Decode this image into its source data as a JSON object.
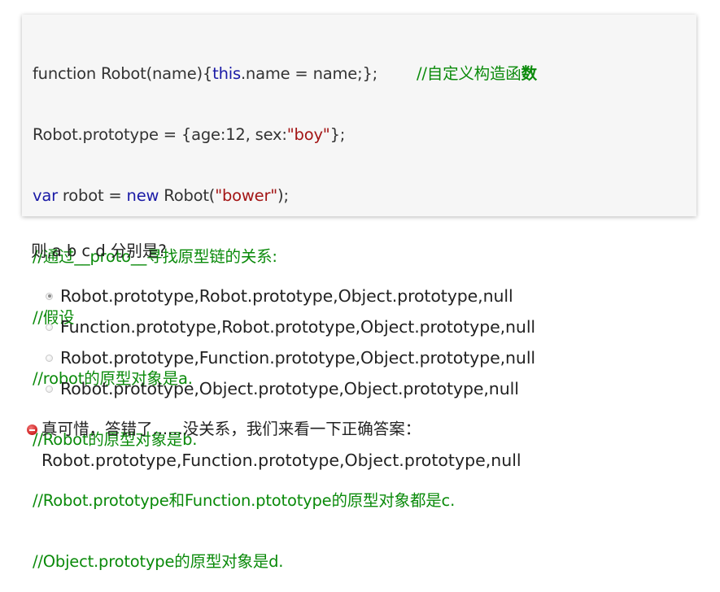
{
  "code": {
    "line1_fn": "function Robot(name){",
    "line1_this": "this",
    "line1_rest": ".name = name;};",
    "line1_gap": "        ",
    "line1_comment": "//自定义构造函",
    "line1_comment_bold": "数",
    "line2": "Robot.prototype = {age:12, sex:",
    "line2_str": "\"boy\"",
    "line2_end": "};",
    "line3_var": "var",
    "line3_mid": " robot = ",
    "line3_new": "new",
    "line3_call": " Robot(",
    "line3_str": "\"bower\"",
    "line3_end": ");",
    "comment1": "//通过__proto__寻找原型链的关系:",
    "comment2": "//假设",
    "comment3": "//robot的原型对象是a.",
    "comment4": "//Robot的原型对象是b.",
    "comment5": "//Robot.prototype和Function.ptototype的原型对象都是c.",
    "comment6": "//Object.prototype的原型对象是d."
  },
  "question": "则,a b c d 分别是?",
  "options": [
    {
      "label": "Robot.prototype,Robot.prototype,Object.prototype,null",
      "checked": true
    },
    {
      "label": "Function.prototype,Robot.prototype,Object.prototype,null",
      "checked": false
    },
    {
      "label": "Robot.prototype,Function.prototype,Object.prototype,null",
      "checked": false
    },
    {
      "label": "Robot.prototype,Object.prototype,Object.prototype,null",
      "checked": false
    }
  ],
  "result": {
    "icon": "error-icon",
    "message": "真可惜，答错了......没关系，我们来看一下正确答案：",
    "answer": "Robot.prototype,Function.prototype,Object.prototype,null"
  },
  "colors": {
    "keyword": "#1a1aa6",
    "string": "#a31515",
    "comment": "#0a8a0a",
    "code_bg": "#f6f6f6",
    "error": "#d42b2b"
  }
}
